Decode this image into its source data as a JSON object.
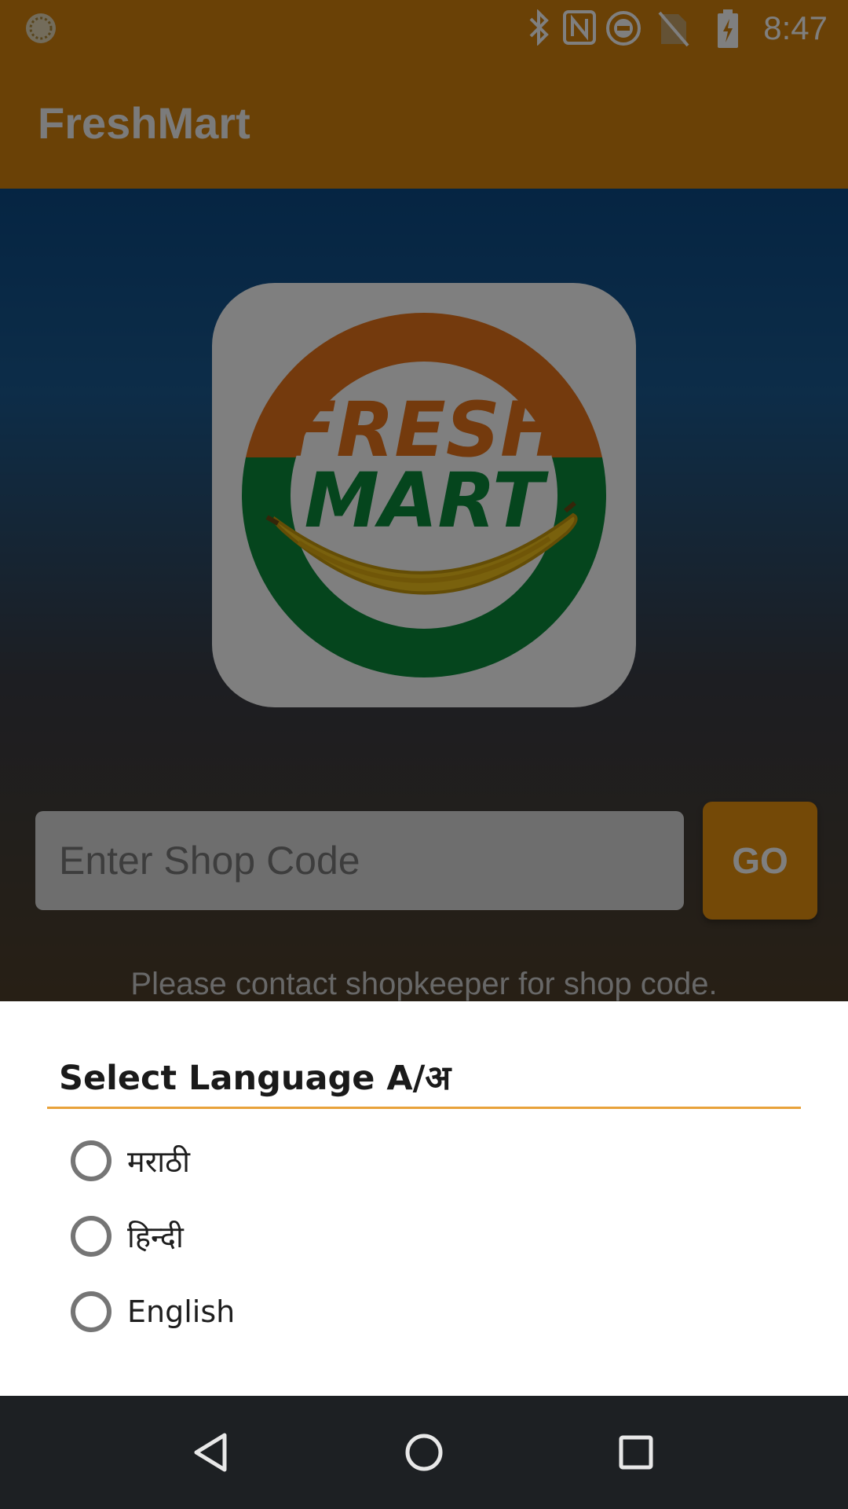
{
  "status_bar": {
    "time": "8:47",
    "icons": [
      "app-notification-icon",
      "bluetooth-icon",
      "nfc-icon",
      "do-not-disturb-icon",
      "no-sim-icon",
      "battery-charging-icon"
    ]
  },
  "app_bar": {
    "title": "FreshMart"
  },
  "logo": {
    "line1": "FRESH",
    "line2": "MART"
  },
  "shop_code": {
    "placeholder": "Enter Shop Code",
    "value": ""
  },
  "go_button": {
    "label": "GO"
  },
  "hint": "Please contact shopkeeper for shop code.",
  "language_dialog": {
    "title": "Select Language A/अ",
    "options": [
      {
        "label": "मराठी",
        "selected": false
      },
      {
        "label": "हिन्दी",
        "selected": false
      },
      {
        "label": "English",
        "selected": false
      }
    ]
  },
  "nav_bar": {
    "buttons": [
      "back-icon",
      "home-icon",
      "recents-icon"
    ]
  },
  "colors": {
    "accent": "#d5820d",
    "divider": "#e8a23a",
    "navbar": "#1d2023"
  }
}
